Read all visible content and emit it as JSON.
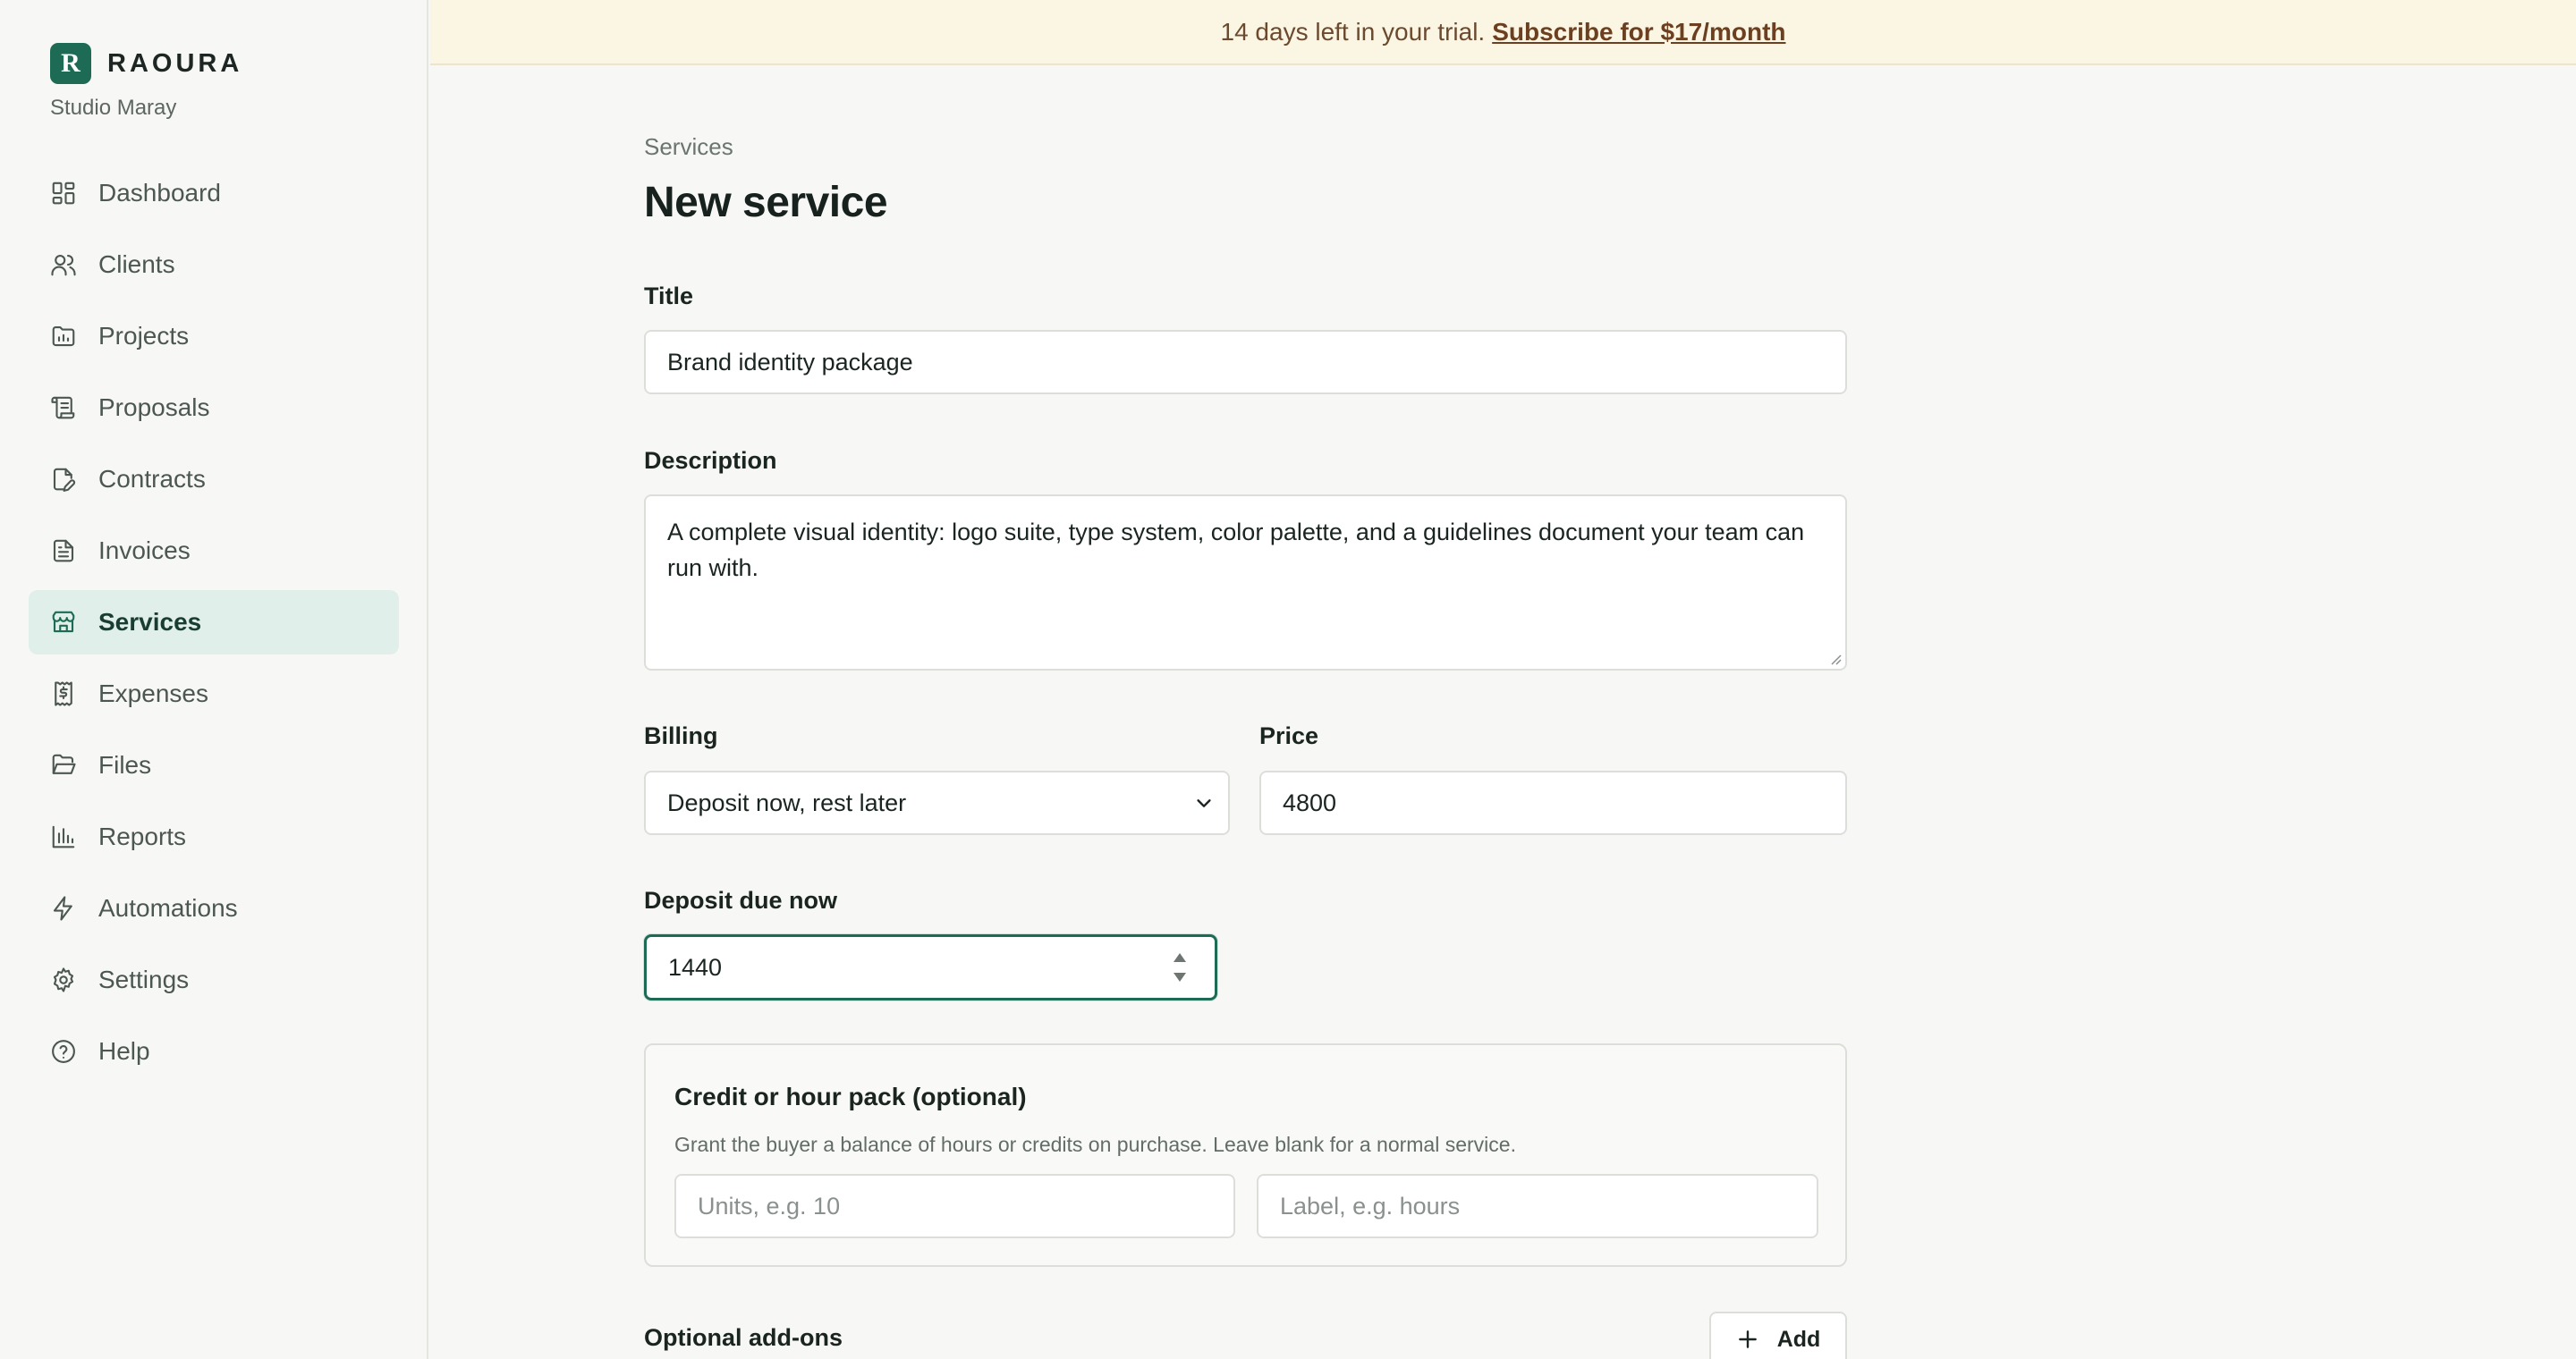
{
  "brand": {
    "mark": "R",
    "name": "RAOURA",
    "workspace": "Studio Maray"
  },
  "banner": {
    "text": "14 days left in your trial.",
    "link": "Subscribe for $17/month"
  },
  "nav": [
    {
      "label": "Dashboard",
      "icon": "dashboard-icon"
    },
    {
      "label": "Clients",
      "icon": "users-icon"
    },
    {
      "label": "Projects",
      "icon": "folder-chart-icon"
    },
    {
      "label": "Proposals",
      "icon": "scroll-icon"
    },
    {
      "label": "Contracts",
      "icon": "file-pen-icon"
    },
    {
      "label": "Invoices",
      "icon": "file-text-icon"
    },
    {
      "label": "Services",
      "icon": "store-icon",
      "active": true
    },
    {
      "label": "Expenses",
      "icon": "receipt-dollar-icon"
    },
    {
      "label": "Files",
      "icon": "folder-open-icon"
    },
    {
      "label": "Reports",
      "icon": "bar-chart-icon"
    },
    {
      "label": "Automations",
      "icon": "zap-icon"
    },
    {
      "label": "Settings",
      "icon": "gear-icon"
    },
    {
      "label": "Help",
      "icon": "help-circle-icon"
    }
  ],
  "page": {
    "breadcrumb": "Services",
    "title": "New service"
  },
  "form": {
    "title_label": "Title",
    "title_value": "Brand identity package",
    "description_label": "Description",
    "description_value": "A complete visual identity: logo suite, type system, color palette, and a guidelines document your team can run with.",
    "billing_label": "Billing",
    "billing_value": "Deposit now, rest later",
    "price_label": "Price",
    "price_value": "4800",
    "deposit_label": "Deposit due now",
    "deposit_value": "1440",
    "pack": {
      "title": "Credit or hour pack (optional)",
      "description": "Grant the buyer a balance of hours or credits on purchase. Leave blank for a normal service.",
      "units_placeholder": "Units, e.g. 10",
      "label_placeholder": "Label, e.g. hours"
    },
    "addons_label": "Optional add-ons",
    "add_button": "Add"
  },
  "colors": {
    "accent": "#1e6b55",
    "active_bg": "#e0efea",
    "banner_bg": "#fbf5e4"
  }
}
